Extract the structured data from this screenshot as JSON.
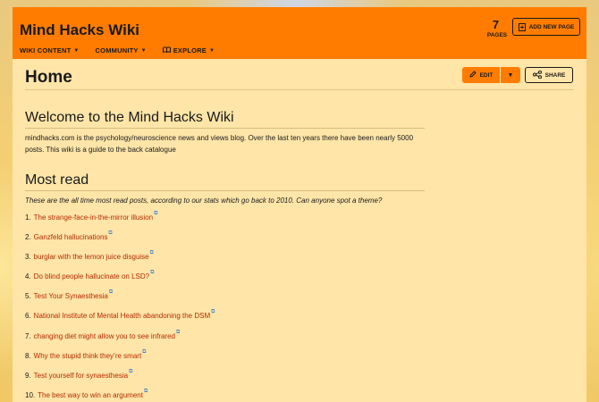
{
  "header": {
    "wiki_name": "Mind Hacks Wiki",
    "nav": [
      {
        "label": "WIKI CONTENT"
      },
      {
        "label": "COMMUNITY"
      },
      {
        "label": "EXPLORE"
      }
    ],
    "pages_count": "7",
    "pages_label": "PAGES",
    "add_page_label": "ADD NEW PAGE"
  },
  "page": {
    "title": "Home",
    "edit_label": "EDIT",
    "share_label": "SHARE"
  },
  "content": {
    "welcome_heading": "Welcome to the Mind Hacks Wiki",
    "intro": "mindhacks.com is the psychology/neuroscience news and views blog. Over the last ten years there have been nearly 5000 posts. This wiki is a guide to the back catalogue",
    "most_read_heading": "Most read",
    "most_read_subtitle": "These are the all time most read posts, according to our stats which go back to 2010. Can anyone spot a theme?",
    "items": [
      {
        "num": "1.",
        "title": "The strange-face-in-the-mirror illusion"
      },
      {
        "num": "2.",
        "title": "Ganzfeld hallucinations"
      },
      {
        "num": "3.",
        "title": "burglar with the lemon juice disguise"
      },
      {
        "num": "4.",
        "title": "Do blind people hallucinate on LSD?"
      },
      {
        "num": "5.",
        "title": "Test Your Synaesthesia"
      },
      {
        "num": "6.",
        "title": "National Institute of Mental Health abandoning the DSM"
      },
      {
        "num": "7.",
        "title": "changing diet might allow you to see infrared"
      },
      {
        "num": "8.",
        "title": "Why the stupid think they’re smart"
      },
      {
        "num": "9.",
        "title": "Test yourself for synaesthesia"
      },
      {
        "num": "10.",
        "title": "The best way to win an argument"
      }
    ]
  },
  "colors": {
    "accent": "#ff7c00",
    "page_background": "#ffe5a8",
    "link": "#b42b00"
  },
  "icons": {
    "add_page": "add-page-icon",
    "edit": "pencil-icon",
    "share": "share-icon",
    "explore": "explore-icon",
    "external": "external-link-icon"
  }
}
